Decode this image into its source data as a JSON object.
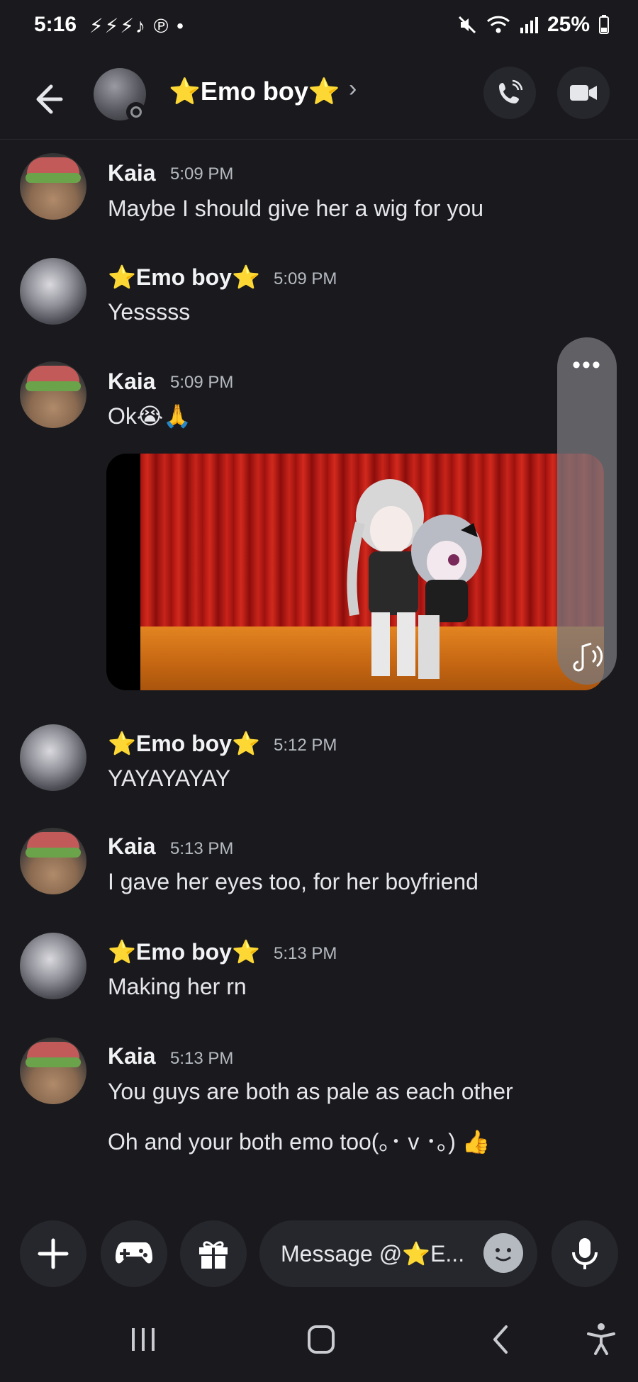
{
  "status_bar": {
    "time": "5:16",
    "notification_icons": "⚡⚡⚡♪ ℗ •",
    "battery": "25%"
  },
  "header": {
    "title": "⭐Emo boy⭐"
  },
  "messages": [
    {
      "author": "Kaia",
      "time": "5:09 PM",
      "lines": [
        "Maybe I should give her a wig for you"
      ],
      "avatar": "kaia"
    },
    {
      "author": "⭐Emo boy⭐",
      "time": "5:09 PM",
      "lines": [
        "Yesssss"
      ],
      "avatar": "emo"
    },
    {
      "author": "Kaia",
      "time": "5:09 PM",
      "lines": [
        "Ok😭🙏"
      ],
      "avatar": "kaia"
    },
    {
      "author": "⭐Emo boy⭐",
      "time": "5:12 PM",
      "lines": [
        "YAYAYAYAY"
      ],
      "avatar": "emo"
    },
    {
      "author": "Kaia",
      "time": "5:13 PM",
      "lines": [
        "I gave her eyes too, for her boyfriend"
      ],
      "avatar": "kaia"
    },
    {
      "author": "⭐Emo boy⭐",
      "time": "5:13 PM",
      "lines": [
        "Making her rn"
      ],
      "avatar": "emo"
    },
    {
      "author": "Kaia",
      "time": "5:13 PM",
      "lines": [
        "You guys are both as pale as each other",
        "Oh and your both emo too(｡･ v ･｡) 👍"
      ],
      "avatar": "kaia"
    }
  ],
  "media": {
    "overlay_dots": "•••"
  },
  "composer": {
    "placeholder": "Message @⭐E..."
  },
  "colors": {
    "background": "#1a1a1e",
    "button_bg": "#26272c",
    "text": "#f2f3f5",
    "muted": "#b5bac1"
  },
  "icons": [
    "back-arrow-icon",
    "phone-icon",
    "video-icon",
    "plus-icon",
    "gamepad-icon",
    "gift-icon",
    "emoji-icon",
    "microphone-icon",
    "recent-apps-icon",
    "home-icon",
    "nav-back-icon",
    "accessibility-icon",
    "sound-icon"
  ]
}
